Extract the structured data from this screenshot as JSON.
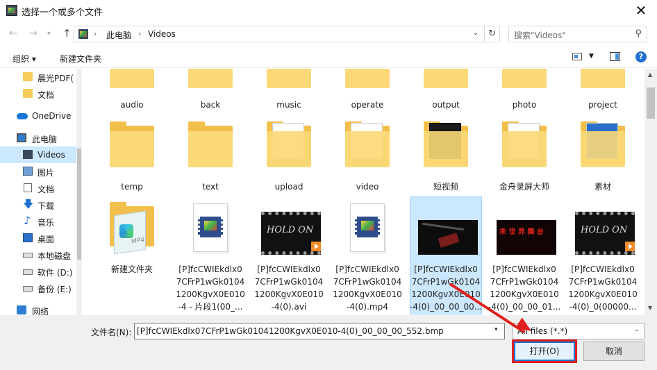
{
  "window": {
    "title": "选择一个或多个文件",
    "close_glyph": "✕"
  },
  "address": {
    "crumbs": [
      "此电脑",
      "Videos"
    ],
    "separator": "›"
  },
  "search": {
    "placeholder": "搜索\"Videos\""
  },
  "toolbar": {
    "organize": "组织 ▾",
    "new_folder": "新建文件夹"
  },
  "sidebar": {
    "items": [
      {
        "label": "晨光PDF(",
        "icon": "folder-icon"
      },
      {
        "label": "文档",
        "icon": "folder-icon"
      },
      {
        "label": "OneDrive",
        "icon": "onedrive-cloud-icon"
      },
      {
        "label": "此电脑",
        "icon": "pc-icon"
      },
      {
        "label": "Videos",
        "icon": "video-folder-icon",
        "selected": true
      },
      {
        "label": "图片",
        "icon": "pictures-icon"
      },
      {
        "label": "文档",
        "icon": "documents-icon"
      },
      {
        "label": "下载",
        "icon": "download-icon"
      },
      {
        "label": "音乐",
        "icon": "music-icon"
      },
      {
        "label": "桌面",
        "icon": "desktop-icon"
      },
      {
        "label": "本地磁盘",
        "icon": "drive-icon"
      },
      {
        "label": "软件 (D:)",
        "icon": "drive-icon"
      },
      {
        "label": "备份 (E:)",
        "icon": "drive-icon"
      },
      {
        "label": "网络",
        "icon": "network-icon"
      }
    ]
  },
  "files": {
    "row1": [
      "audio",
      "back",
      "music",
      "operate",
      "output",
      "photo",
      "project"
    ],
    "row2": [
      "temp",
      "text",
      "upload",
      "video",
      "短视频",
      "金舟录屏大师",
      "素材"
    ],
    "row3": [
      {
        "lines": [
          "新建文件夹"
        ],
        "kind": "folder-mp4"
      },
      {
        "lines": [
          "[P]fcCWIEkdlx0",
          "7CFrP1wGk0104",
          "1200KgvX0E010",
          "-4 - 片段1(00_..."
        ],
        "kind": "doc-video"
      },
      {
        "lines": [
          "[P]fcCWIEkdlx0",
          "7CFrP1wGk0104",
          "1200KgvX0E010",
          "-4(0).avi"
        ],
        "kind": "video-thumb",
        "thumb_text": "HOLD ON"
      },
      {
        "lines": [
          "[P]fcCWIEkdlx0",
          "7CFrP1wGk0104",
          "1200KgvX0E010",
          "-4(0).mp4"
        ],
        "kind": "doc-video"
      },
      {
        "lines": [
          "[P]fcCWIEkdlx0",
          "7CFrP1wGk0104",
          "1200KgvX0E010",
          "-4(0)_00_00_00..."
        ],
        "kind": "image-thumb",
        "selected": true
      },
      {
        "lines": [
          "[P]fcCWIEkdlx0",
          "7CFrP1wGk0104",
          "1200KgvX0E010",
          "-4(0)_00_00_01..."
        ],
        "kind": "video-thumb",
        "thumb_text": "未 世 界 舞 台"
      },
      {
        "lines": [
          "[P]fcCWIEkdlx0",
          "7CFrP1wGk0104",
          "1200KgvX0E010",
          "-4(0)_0(00000..."
        ],
        "kind": "video-thumb",
        "thumb_text": "HOLD ON"
      }
    ]
  },
  "bottom": {
    "filename_label": "文件名(N):",
    "filename_value": "[P]fcCWIEkdlx07CFrP1wGk01041200KgvX0E010-4(0)_00_00_00_552.bmp",
    "filter_value": "All files (*.*)",
    "open_label": "打开(O)",
    "cancel_label": "取消"
  },
  "colors": {
    "accent": "#0078d7",
    "selection": "#cce8ff",
    "annotation": "#e0201c",
    "folder": "#f6cd5b"
  }
}
